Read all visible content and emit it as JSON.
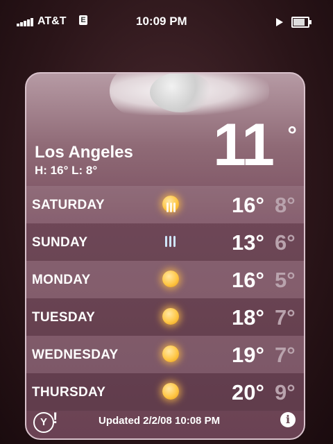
{
  "status_bar": {
    "carrier": "AT&T",
    "network": "E",
    "time": "10:09 PM",
    "icons": [
      "signal-bars-icon",
      "play-icon",
      "battery-icon"
    ]
  },
  "weather": {
    "current_temp": "11",
    "current_unit": "°",
    "city": "Los Angeles",
    "hilo": "H: 16° L: 8°",
    "forecast": [
      {
        "day": "SATURDAY",
        "icon": "sun-with-rain-icon",
        "high": "16°",
        "low": "8°"
      },
      {
        "day": "SUNDAY",
        "icon": "rain-icon",
        "high": "13°",
        "low": "6°"
      },
      {
        "day": "MONDAY",
        "icon": "sun-icon",
        "high": "16°",
        "low": "5°"
      },
      {
        "day": "TUESDAY",
        "icon": "sun-icon",
        "high": "18°",
        "low": "7°"
      },
      {
        "day": "WEDNESDAY",
        "icon": "sun-icon",
        "high": "19°",
        "low": "7°"
      },
      {
        "day": "THURSDAY",
        "icon": "sun-icon",
        "high": "20°",
        "low": "9°"
      }
    ],
    "footer": {
      "updated": "Updated 2/2/08 10:08 PM",
      "yahoo_icon_label": "Y",
      "yahoo_bang": "!",
      "info_icon_label": "i"
    }
  }
}
